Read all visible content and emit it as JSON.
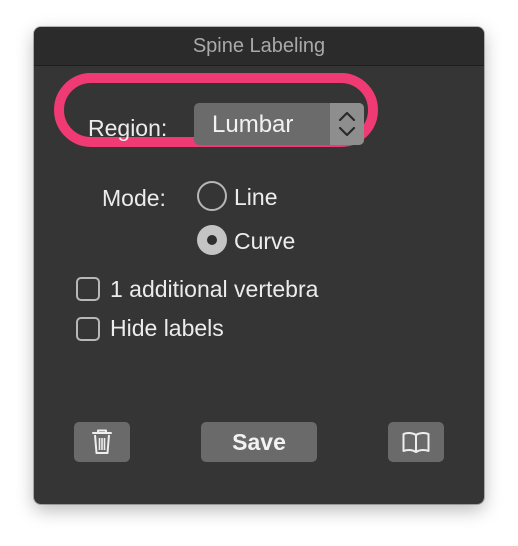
{
  "window": {
    "title": "Spine Labeling"
  },
  "region": {
    "label": "Region:",
    "selected": "Lumbar",
    "highlight_color": "#f03a74",
    "stepper_icon": "up-down-chevrons-icon"
  },
  "mode": {
    "label": "Mode:",
    "options": [
      {
        "label": "Line",
        "selected": false
      },
      {
        "label": "Curve",
        "selected": true
      }
    ]
  },
  "checkboxes": [
    {
      "label": "1 additional vertebra",
      "checked": false
    },
    {
      "label": "Hide labels",
      "checked": false
    }
  ],
  "buttons": {
    "trash_icon": "trash-icon",
    "save_label": "Save",
    "help_icon": "book-icon"
  },
  "colors": {
    "panel_bg": "#353535",
    "titlebar_bg": "#2b2b2b",
    "button_bg": "#6a6a6a"
  }
}
